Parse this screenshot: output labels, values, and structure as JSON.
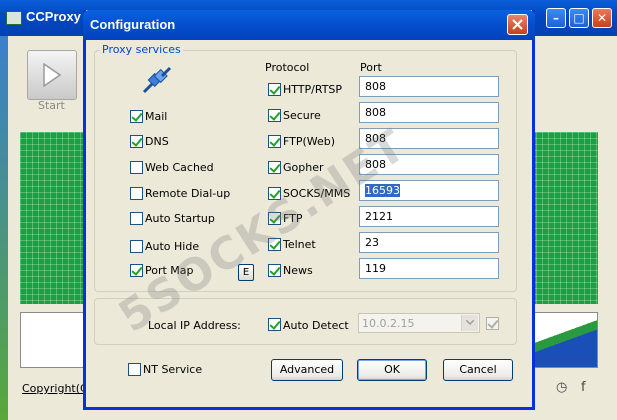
{
  "main_window": {
    "title": "CCProxy",
    "start_label": "Start",
    "copyright_label": "Copyright(C)"
  },
  "dialog": {
    "title": "Configuration",
    "group_title": "Proxy services",
    "protocol_header": "Protocol",
    "port_header": "Port",
    "services": [
      {
        "label": "Mail",
        "checked": true
      },
      {
        "label": "DNS",
        "checked": true
      },
      {
        "label": "Web Cached",
        "checked": false
      },
      {
        "label": "Remote Dial-up",
        "checked": false
      },
      {
        "label": "Auto Startup",
        "checked": false
      },
      {
        "label": "Auto Hide",
        "checked": false
      },
      {
        "label": "Port Map",
        "checked": true
      }
    ],
    "port_map_edit_label": "E",
    "protocols": [
      {
        "label": "HTTP/RTSP",
        "checked": true,
        "port": "808"
      },
      {
        "label": "Secure",
        "checked": true,
        "port": "808"
      },
      {
        "label": "FTP(Web)",
        "checked": true,
        "port": "808"
      },
      {
        "label": "Gopher",
        "checked": true,
        "port": "808"
      },
      {
        "label": "SOCKS/MMS",
        "checked": true,
        "port": "16593"
      },
      {
        "label": "FTP",
        "checked": true,
        "port": "2121"
      },
      {
        "label": "Telnet",
        "checked": true,
        "port": "23"
      },
      {
        "label": "News",
        "checked": true,
        "port": "119"
      }
    ],
    "local_ip_label": "Local IP Address:",
    "auto_detect_label": "Auto Detect",
    "auto_detect_checked": true,
    "local_ip_value": "10.0.2.15",
    "nt_service_label": "NT Service",
    "nt_service_checked": false,
    "buttons": {
      "advanced": "Advanced",
      "ok": "OK",
      "cancel": "Cancel"
    }
  },
  "watermark": "5SOCKS.NET",
  "colors": {
    "titlebar": "#0450d0",
    "dialog_bg": "#ece9d8",
    "group_title": "#0046d5",
    "grid_green": "#1aa043"
  }
}
